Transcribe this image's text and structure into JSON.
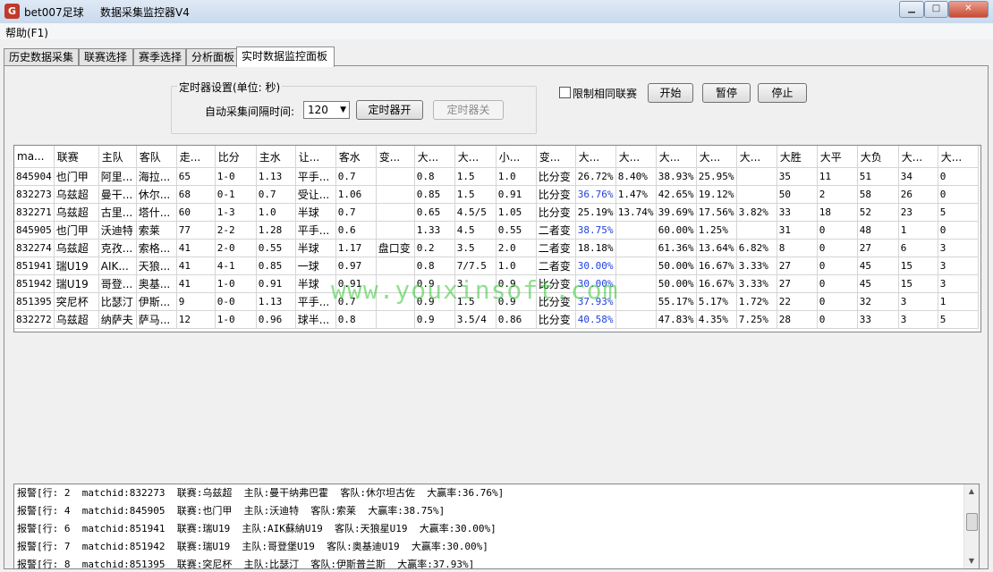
{
  "window": {
    "app_name": "bet007足球",
    "title": "数据采集监控器V4",
    "app_icon_glyph": "G",
    "minimize_glyph": "▁",
    "maximize_glyph": "□",
    "close_glyph": "✕"
  },
  "menu": {
    "help": "帮助(F1)"
  },
  "tabs": [
    {
      "label": "历史数据采集"
    },
    {
      "label": "联赛选择"
    },
    {
      "label": "赛季选择"
    },
    {
      "label": "分析面板"
    },
    {
      "label": "实时数据监控面板",
      "active": true
    }
  ],
  "timer": {
    "group_label": "定时器设置(单位: 秒)",
    "interval_label": "自动采集间隔时间:",
    "interval_value": "120",
    "start_button": "定时器开",
    "stop_button": "定时器关"
  },
  "controls": {
    "limit_same_league": "限制相同联赛",
    "start": "开始",
    "pause": "暂停",
    "stop": "停止"
  },
  "grid": {
    "columns": [
      "ma...",
      "联赛",
      "主队",
      "客队",
      "走...",
      "比分",
      "主水",
      "让...",
      "客水",
      "变...",
      "大...",
      "大...",
      "小...",
      "变...",
      "大...",
      "大...",
      "大...",
      "大...",
      "大...",
      "大胜",
      "大平",
      "大负",
      "大...",
      "大..."
    ],
    "rows": [
      [
        "845904",
        "也门甲",
        "阿里...",
        "海拉...",
        "65",
        "1-0",
        "1.13",
        "平手...",
        "0.7",
        "",
        "0.8",
        "1.5",
        "1.0",
        "比分变",
        "26.72%",
        "8.40%",
        "38.93%",
        "25.95%",
        "",
        "35",
        "11",
        "51",
        "34",
        "0"
      ],
      [
        "832273",
        "乌兹超",
        "曼干...",
        "休尔...",
        "68",
        "0-1",
        "0.7",
        "受让...",
        "1.06",
        "",
        "0.85",
        "1.5",
        "0.91",
        "比分变",
        "36.76%",
        "1.47%",
        "42.65%",
        "19.12%",
        "",
        "50",
        "2",
        "58",
        "26",
        "0"
      ],
      [
        "832271",
        "乌兹超",
        "古里...",
        "塔什...",
        "60",
        "1-3",
        "1.0",
        "半球",
        "0.7",
        "",
        "0.65",
        "4.5/5",
        "1.05",
        "比分变",
        "25.19%",
        "13.74%",
        "39.69%",
        "17.56%",
        "3.82%",
        "33",
        "18",
        "52",
        "23",
        "5"
      ],
      [
        "845905",
        "也门甲",
        "沃迪特",
        "索莱",
        "77",
        "2-2",
        "1.28",
        "平手...",
        "0.6",
        "",
        "1.33",
        "4.5",
        "0.55",
        "二者变",
        "38.75%",
        "",
        "60.00%",
        "1.25%",
        "",
        "31",
        "0",
        "48",
        "1",
        "0"
      ],
      [
        "832274",
        "乌兹超",
        "克孜...",
        "索格...",
        "41",
        "2-0",
        "0.55",
        "半球",
        "1.17",
        "盘口变",
        "0.2",
        "3.5",
        "2.0",
        "二者变",
        "18.18%",
        "",
        "61.36%",
        "13.64%",
        "6.82%",
        "8",
        "0",
        "27",
        "6",
        "3"
      ],
      [
        "851941",
        "瑞U19",
        "AIK...",
        "天狼...",
        "41",
        "4-1",
        "0.85",
        "一球",
        "0.97",
        "",
        "0.8",
        "7/7.5",
        "1.0",
        "二者变",
        "30.00%",
        "",
        "50.00%",
        "16.67%",
        "3.33%",
        "27",
        "0",
        "45",
        "15",
        "3"
      ],
      [
        "851942",
        "瑞U19",
        "哥登...",
        "奥基...",
        "41",
        "1-0",
        "0.91",
        "半球",
        "0.91",
        "",
        "0.9",
        "3",
        "0.9",
        "比分变",
        "30.00%",
        "",
        "50.00%",
        "16.67%",
        "3.33%",
        "27",
        "0",
        "45",
        "15",
        "3"
      ],
      [
        "851395",
        "突尼杯",
        "比瑟汀",
        "伊斯...",
        "9",
        "0-0",
        "1.13",
        "平手...",
        "0.7",
        "",
        "0.9",
        "1.5",
        "0.9",
        "比分变",
        "37.93%",
        "",
        "55.17%",
        "5.17%",
        "1.72%",
        "22",
        "0",
        "32",
        "3",
        "1"
      ],
      [
        "832272",
        "乌兹超",
        "纳萨夫",
        "萨马...",
        "12",
        "1-0",
        "0.96",
        "球半...",
        "0.8",
        "",
        "0.9",
        "3.5/4",
        "0.86",
        "比分变",
        "40.58%",
        "",
        "47.83%",
        "4.35%",
        "7.25%",
        "28",
        "0",
        "33",
        "3",
        "5"
      ]
    ],
    "highlight_color": "#1f3fe0",
    "highlighted_rows": [
      1,
      3,
      5,
      6,
      7,
      8
    ]
  },
  "watermark": "www.youxinsoft.com",
  "log": [
    "报警[行: 2  matchid:832273  联赛:乌兹超  主队:曼干纳弗巴霍  客队:休尔坦古佐  大赢率:36.76%]",
    "报警[行: 4  matchid:845905  联赛:也门甲  主队:沃迪特  客队:索莱  大赢率:38.75%]",
    "报警[行: 6  matchid:851941  联赛:瑞U19  主队:AIK蘇納U19  客队:天狼星U19  大赢率:30.00%]",
    "报警[行: 7  matchid:851942  联赛:瑞U19  主队:哥登堡U19  客队:奥基迪U19  大赢率:30.00%]",
    "报警[行: 8  matchid:851395  联赛:突尼杯  主队:比瑟汀  客队:伊斯普兰斯  大赢率:37.93%]"
  ],
  "icons": {
    "dropdown": "▼",
    "scroll_up": "▲",
    "scroll_down": "▼"
  }
}
